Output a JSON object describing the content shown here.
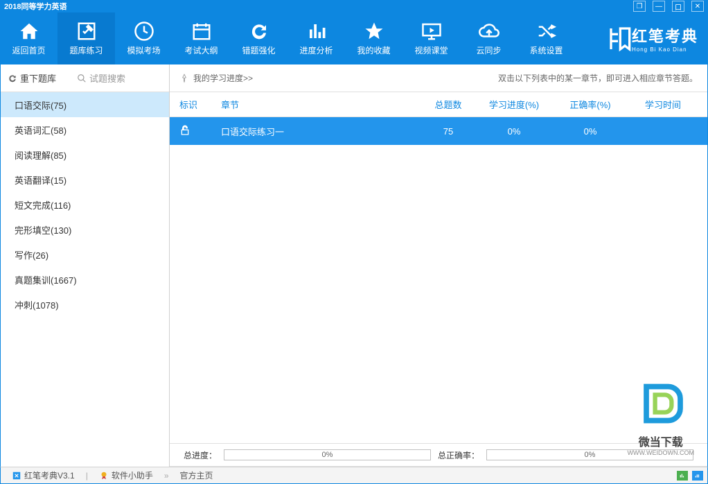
{
  "titlebar": {
    "text": "2018同等学力英语"
  },
  "toolbar": {
    "items": [
      {
        "label": "返回首页"
      },
      {
        "label": "题库练习"
      },
      {
        "label": "模拟考场"
      },
      {
        "label": "考试大纲"
      },
      {
        "label": "错题强化"
      },
      {
        "label": "进度分析"
      },
      {
        "label": "我的收藏"
      },
      {
        "label": "视频课堂"
      },
      {
        "label": "云同步"
      },
      {
        "label": "系统设置"
      }
    ]
  },
  "brand": {
    "main": "红笔考典",
    "sub": "Hong Bi Kao Dian"
  },
  "sidebar": {
    "reload": "重下题库",
    "search": "试题搜索",
    "items": [
      {
        "label": "口语交际(75)"
      },
      {
        "label": "英语词汇(58)"
      },
      {
        "label": "阅读理解(85)"
      },
      {
        "label": "英语翻译(15)"
      },
      {
        "label": "短文完成(116)"
      },
      {
        "label": "完形填空(130)"
      },
      {
        "label": "写作(26)"
      },
      {
        "label": "真题集训(1667)"
      },
      {
        "label": "冲刺(1078)"
      }
    ]
  },
  "progress": {
    "title": "我的学习进度>>",
    "hint": "双击以下列表中的某一章节，即可进入相应章节答题。"
  },
  "table": {
    "headers": {
      "mark": "标识",
      "chapter": "章节",
      "total": "总题数",
      "progress": "学习进度(%)",
      "correct": "正确率(%)",
      "time": "学习时间"
    },
    "rows": [
      {
        "chapter": "口语交际练习一",
        "total": "75",
        "progress": "0%",
        "correct": "0%",
        "time": ""
      }
    ]
  },
  "summary": {
    "total_label": "总进度：",
    "total_value": "0%",
    "correct_label": "总正确率：",
    "correct_value": "0%"
  },
  "status": {
    "app": "红笔考典V3.1",
    "helper": "软件小助手",
    "home": "官方主页"
  },
  "watermark": {
    "text": "微当下载",
    "url": "WWW.WEIDOWN.COM"
  }
}
